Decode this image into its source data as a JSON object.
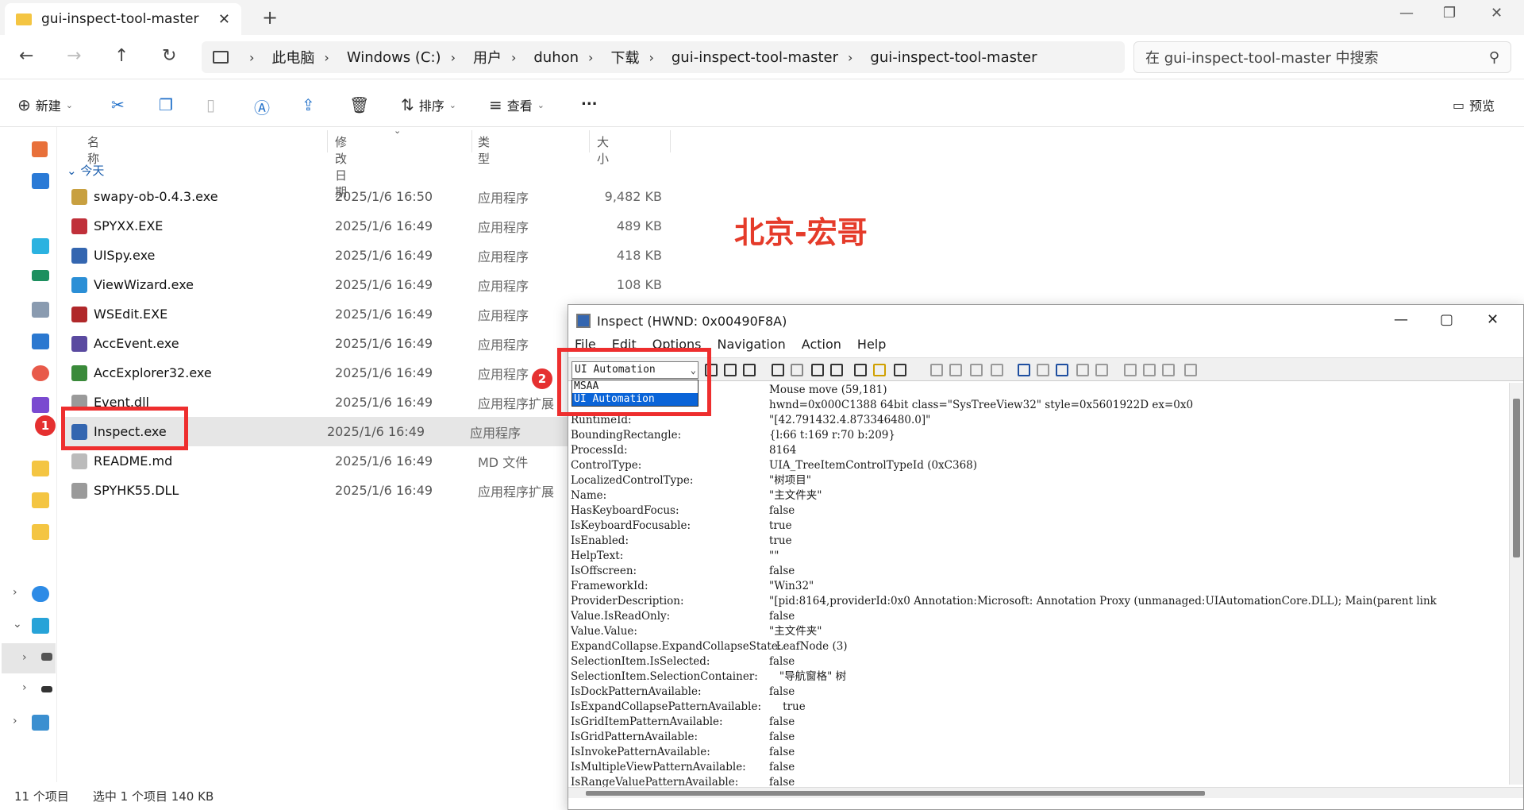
{
  "explorer": {
    "tab_title": "gui-inspect-tool-master",
    "breadcrumb": [
      "此电脑",
      "Windows (C:)",
      "用户",
      "duhon",
      "下载",
      "gui-inspect-tool-master",
      "gui-inspect-tool-master"
    ],
    "search_placeholder": "在 gui-inspect-tool-master 中搜索",
    "toolbar": {
      "new": "新建",
      "sort": "排序",
      "view": "查看",
      "more": "...",
      "preview": "预览"
    },
    "columns": {
      "name": "名称",
      "date": "修改日期",
      "type": "类型",
      "size": "大小"
    },
    "group": "今天",
    "files": [
      {
        "name": "swapy-ob-0.4.3.exe",
        "date": "2025/1/6 16:50",
        "type": "应用程序",
        "size": "9,482 KB",
        "icon_color": "#c8a040"
      },
      {
        "name": "SPYXX.EXE",
        "date": "2025/1/6 16:49",
        "type": "应用程序",
        "size": "489 KB",
        "icon_color": "#c0303a"
      },
      {
        "name": "UISpy.exe",
        "date": "2025/1/6 16:49",
        "type": "应用程序",
        "size": "418 KB",
        "icon_color": "#3466b0"
      },
      {
        "name": "ViewWizard.exe",
        "date": "2025/1/6 16:49",
        "type": "应用程序",
        "size": "108 KB",
        "icon_color": "#2b8fd6"
      },
      {
        "name": "WSEdit.EXE",
        "date": "2025/1/6 16:49",
        "type": "应用程序",
        "size": "",
        "icon_color": "#b0282a"
      },
      {
        "name": "AccEvent.exe",
        "date": "2025/1/6 16:49",
        "type": "应用程序",
        "size": "",
        "icon_color": "#5a4aa0"
      },
      {
        "name": "AccExplorer32.exe",
        "date": "2025/1/6 16:49",
        "type": "应用程序",
        "size": "",
        "icon_color": "#3a8a3a"
      },
      {
        "name": "Event.dll",
        "date": "2025/1/6 16:49",
        "type": "应用程序扩展",
        "size": "",
        "icon_color": "#9a9a9a"
      },
      {
        "name": "Inspect.exe",
        "date": "2025/1/6 16:49",
        "type": "应用程序",
        "size": "",
        "icon_color": "#3466b0"
      },
      {
        "name": "README.md",
        "date": "2025/1/6 16:49",
        "type": "MD 文件",
        "size": "",
        "icon_color": "#bbbbbb"
      },
      {
        "name": "SPYHK55.DLL",
        "date": "2025/1/6 16:49",
        "type": "应用程序扩展",
        "size": "",
        "icon_color": "#9a9a9a"
      }
    ],
    "status": {
      "count": "11 个项目",
      "selected": "选中 1 个项目  140 KB"
    }
  },
  "watermark": "北京-宏哥",
  "badges": [
    "1",
    "2"
  ],
  "inspect": {
    "title": "Inspect  (HWND: 0x00490F8A)",
    "menu": [
      "File",
      "Edit",
      "Options",
      "Navigation",
      "Action",
      "Help"
    ],
    "combo_value": "UI Automation",
    "dropdown_options": [
      "MSAA",
      "UI Automation"
    ],
    "properties": [
      {
        "k": "",
        "v": "Mouse move (59,181)"
      },
      {
        "k": "",
        "v": "hwnd=0x000C1388 64bit class=\"SysTreeView32\" style=0x5601922D ex=0x0"
      },
      {
        "k": "RuntimeId:",
        "v": "\"[42.791432.4.873346480.0]\""
      },
      {
        "k": "BoundingRectangle:",
        "v": "{l:66 t:169 r:70 b:209}"
      },
      {
        "k": "ProcessId:",
        "v": "8164"
      },
      {
        "k": "ControlType:",
        "v": "UIA_TreeItemControlTypeId (0xC368)"
      },
      {
        "k": "LocalizedControlType:",
        "v": "\"树项目\""
      },
      {
        "k": "Name:",
        "v": "\"主文件夹\""
      },
      {
        "k": "HasKeyboardFocus:",
        "v": "false"
      },
      {
        "k": "IsKeyboardFocusable:",
        "v": "true"
      },
      {
        "k": "IsEnabled:",
        "v": "true"
      },
      {
        "k": "HelpText:",
        "v": "\"\""
      },
      {
        "k": "IsOffscreen:",
        "v": "false"
      },
      {
        "k": "FrameworkId:",
        "v": "\"Win32\""
      },
      {
        "k": "ProviderDescription:",
        "v": "\"[pid:8164,providerId:0x0 Annotation:Microsoft: Annotation Proxy (unmanaged:UIAutomationCore.DLL); Main(parent link"
      },
      {
        "k": "Value.IsReadOnly:",
        "v": "false"
      },
      {
        "k": "Value.Value:",
        "v": "\"主文件夹\""
      },
      {
        "k": "ExpandCollapse.ExpandCollapseState:",
        "v": "  LeafNode (3)"
      },
      {
        "k": "SelectionItem.IsSelected:",
        "v": "false"
      },
      {
        "k": "SelectionItem.SelectionContainer:",
        "v": "   \"导航窗格\" 树"
      },
      {
        "k": "IsDockPatternAvailable:",
        "v": "false"
      },
      {
        "k": "IsExpandCollapsePatternAvailable:",
        "v": "    true"
      },
      {
        "k": "IsGridItemPatternAvailable:",
        "v": "false"
      },
      {
        "k": "IsGridPatternAvailable:",
        "v": "false"
      },
      {
        "k": "IsInvokePatternAvailable:",
        "v": "false"
      },
      {
        "k": "IsMultipleViewPatternAvailable:",
        "v": "false"
      },
      {
        "k": "IsRangeValuePatternAvailable:",
        "v": "false"
      }
    ]
  }
}
